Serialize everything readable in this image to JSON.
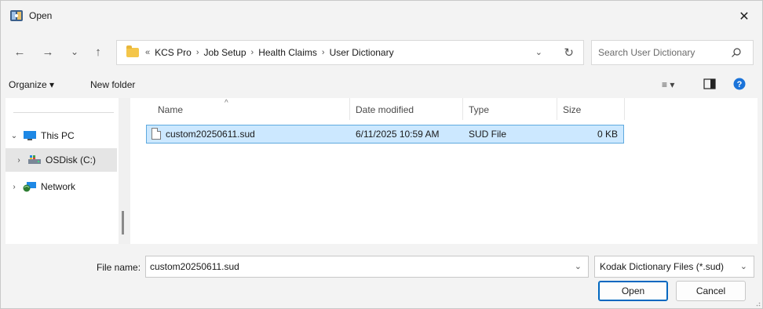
{
  "window": {
    "title": "Open",
    "close_glyph": "✕"
  },
  "nav": {
    "back_glyph": "←",
    "forward_glyph": "→",
    "recent_glyph": "⌄",
    "up_glyph": "↑"
  },
  "address": {
    "overflow": "«",
    "crumbs": [
      "KCS Pro",
      "Job Setup",
      "Health Claims",
      "User Dictionary"
    ],
    "separator": "›",
    "dropdown_glyph": "⌄",
    "refresh_glyph": "↻"
  },
  "search": {
    "placeholder": "Search User Dictionary"
  },
  "commandbar": {
    "organize": "Organize ▾",
    "new_folder": "New folder",
    "view_glyph": "≡ ▾"
  },
  "navpane": {
    "items": [
      {
        "label": "This PC",
        "chevron": "⌄",
        "icon": "monitor-icon"
      },
      {
        "label": "OSDisk (C:)",
        "chevron": "›",
        "icon": "drive-icon"
      },
      {
        "label": "Network",
        "chevron": "›",
        "icon": "network-icon"
      }
    ]
  },
  "files": {
    "columns": [
      "Name",
      "Date modified",
      "Type",
      "Size"
    ],
    "sort_glyph": "^",
    "rows": [
      {
        "name": "custom20250611.sud",
        "date": "6/11/2025 10:59 AM",
        "type": "SUD File",
        "size": "0 KB"
      }
    ]
  },
  "footer": {
    "file_name_label": "File name:",
    "file_name_value": "custom20250611.sud",
    "file_type": "Kodak Dictionary Files (*.sud)",
    "open_label": "Open",
    "cancel_label": "Cancel",
    "dropdown_glyph": "⌄"
  },
  "colors": {
    "accent": "#0067c0",
    "selection": "#cce8ff",
    "selection_border": "#5ea9de"
  }
}
